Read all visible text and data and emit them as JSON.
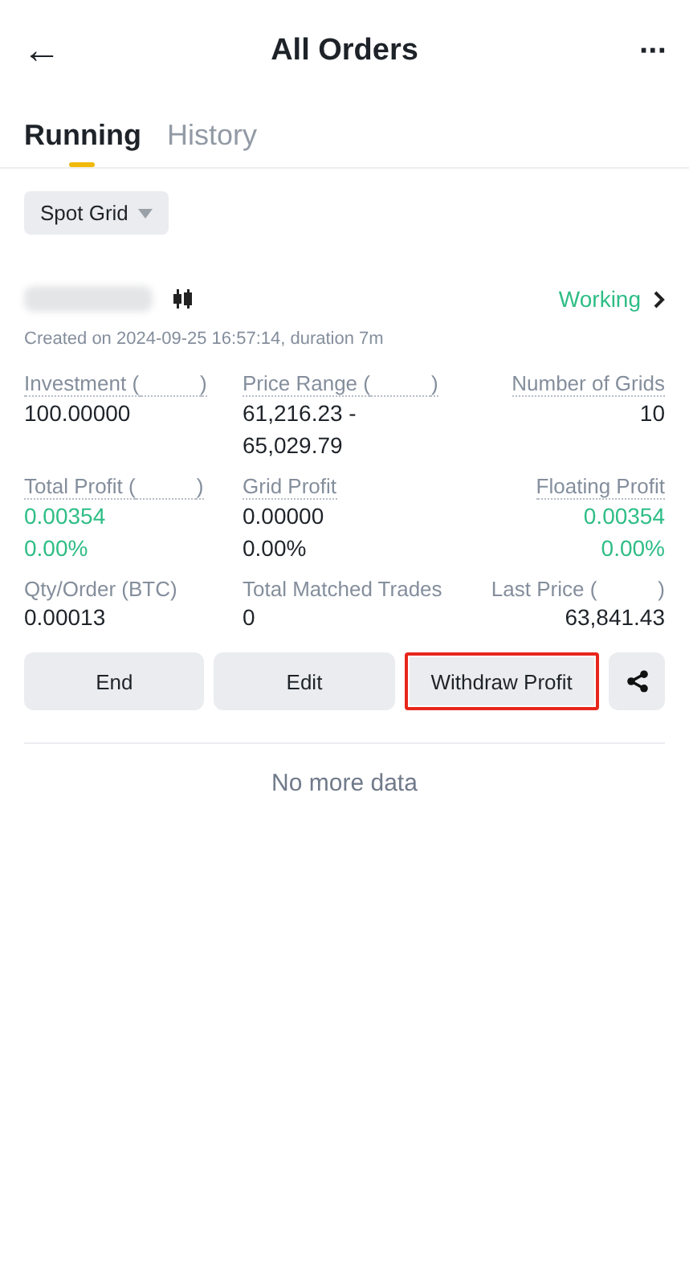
{
  "header": {
    "back_icon": "←",
    "title": "All Orders",
    "more_icon": "···"
  },
  "tabs": [
    {
      "label": "Running",
      "selected": true
    },
    {
      "label": "History",
      "selected": false
    }
  ],
  "filter": {
    "label": "Spot Grid"
  },
  "order": {
    "pair_blurred": true,
    "status": "Working",
    "created": "Created on 2024-09-25 16:57:14, duration 7m",
    "metrics": [
      {
        "label": "Investment (",
        "label_end": ")",
        "dotted": true,
        "values": [
          {
            "text": "100.00000",
            "positive": false
          }
        ]
      },
      {
        "label": "Price Range (",
        "label_end": ")",
        "dotted": true,
        "values": [
          {
            "text": "61,216.23 -",
            "positive": false
          },
          {
            "text": "65,029.79",
            "positive": false
          }
        ]
      },
      {
        "label": "Number of Grids",
        "dotted": true,
        "values": [
          {
            "text": "10",
            "positive": false
          }
        ]
      },
      {
        "label": "Total Profit (",
        "label_end": ")",
        "dotted": true,
        "values": [
          {
            "text": "0.00354",
            "positive": true
          },
          {
            "text": "0.00%",
            "positive": true
          }
        ]
      },
      {
        "label": "Grid Profit",
        "dotted": true,
        "values": [
          {
            "text": "0.00000",
            "positive": false
          },
          {
            "text": "0.00%",
            "positive": false
          }
        ]
      },
      {
        "label": "Floating Profit",
        "dotted": true,
        "values": [
          {
            "text": "0.00354",
            "positive": true
          },
          {
            "text": "0.00%",
            "positive": true
          }
        ]
      },
      {
        "label": "Qty/Order (BTC)",
        "dotted": false,
        "values": [
          {
            "text": "0.00013",
            "positive": false
          }
        ]
      },
      {
        "label": "Total Matched Trades",
        "dotted": false,
        "values": [
          {
            "text": "0",
            "positive": false
          }
        ]
      },
      {
        "label": "Last Price (",
        "label_end": ")",
        "dotted": false,
        "values": [
          {
            "text": "63,841.43",
            "positive": false
          }
        ]
      }
    ],
    "buttons": [
      {
        "label": "End",
        "highlighted": false
      },
      {
        "label": "Edit",
        "highlighted": false
      },
      {
        "label": "Withdraw Profit",
        "highlighted": true
      }
    ]
  },
  "footer": "No more data"
}
